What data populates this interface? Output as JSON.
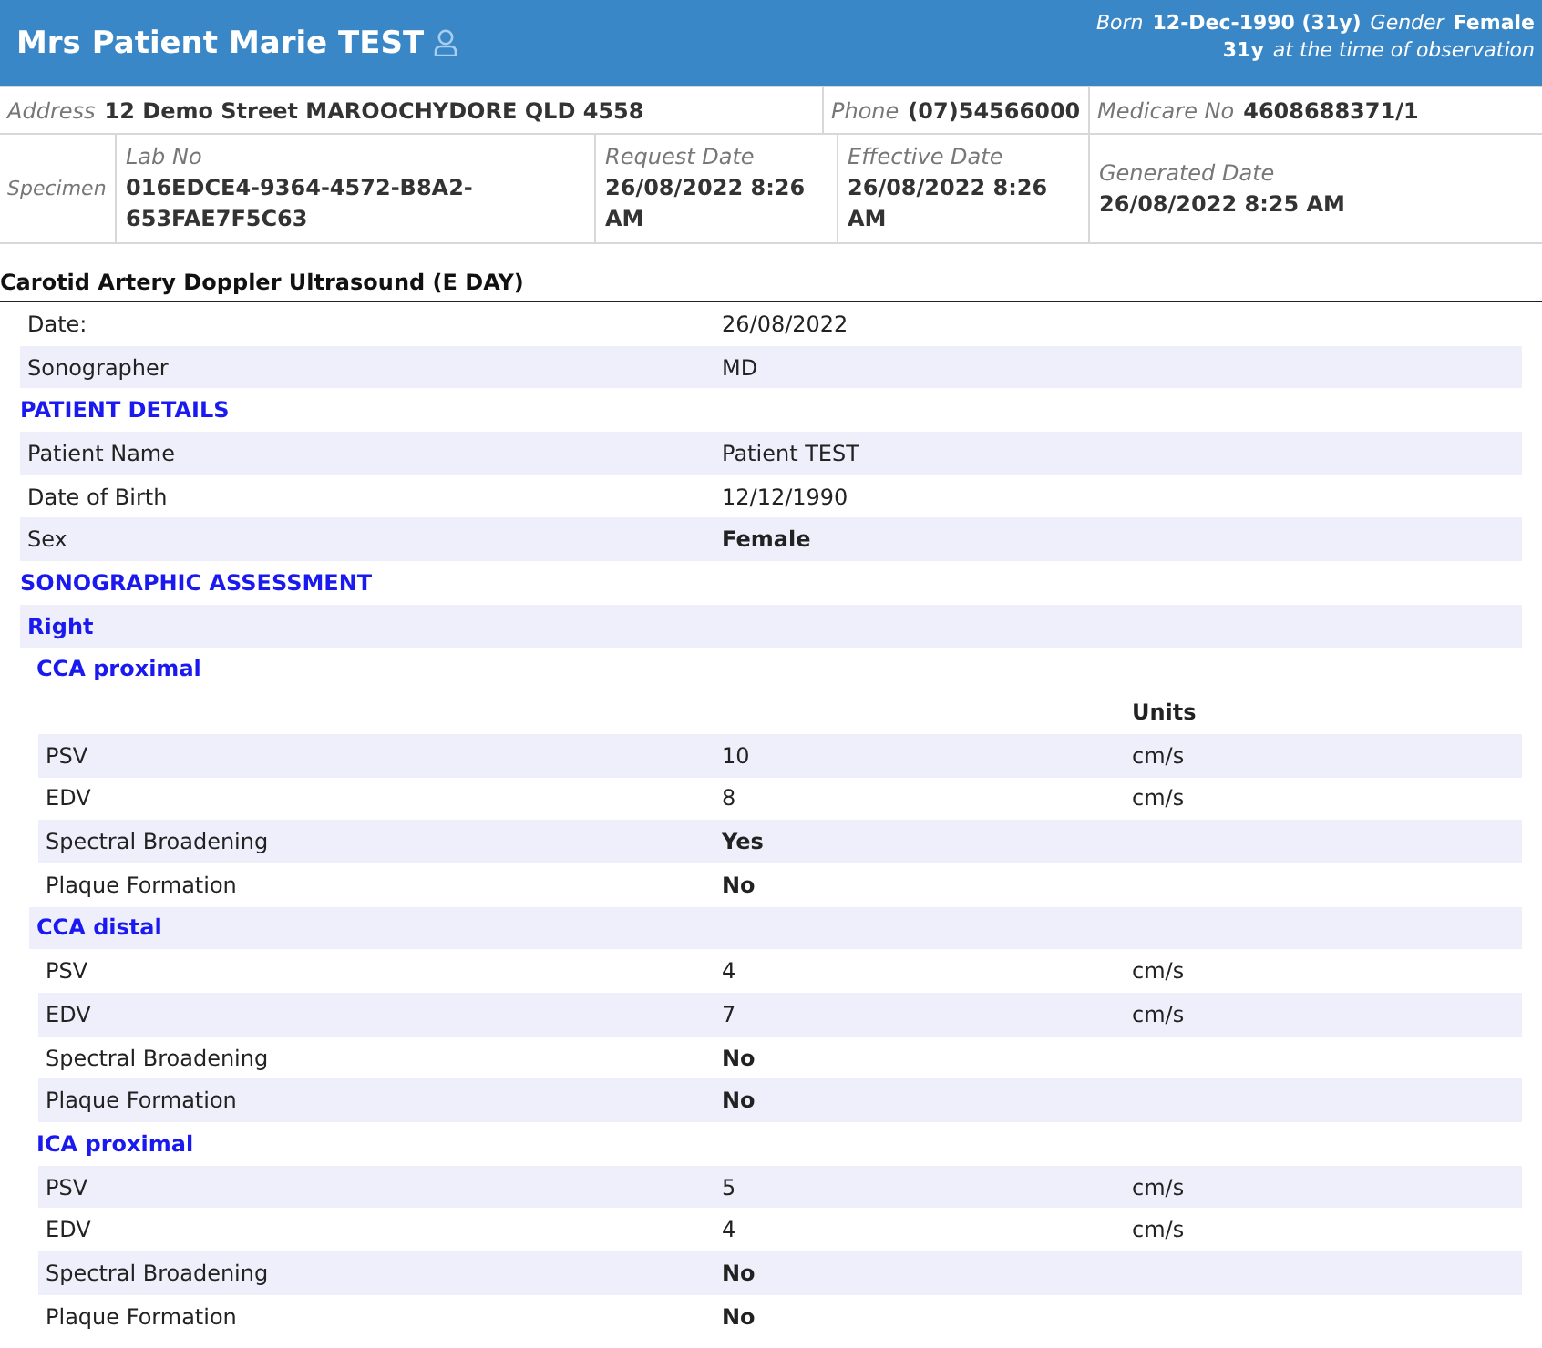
{
  "patient": {
    "name": "Mrs Patient Marie TEST",
    "born_label": "Born",
    "born": "12-Dec-1990 (31y)",
    "gender_label": "Gender",
    "gender": "Female",
    "age": "31y",
    "age_note": "at the time of observation"
  },
  "info": {
    "address_label": "Address",
    "address": "12 Demo Street MAROOCHYDORE QLD 4558",
    "phone_label": "Phone",
    "phone": "(07)54566000",
    "medicare_label": "Medicare No",
    "medicare": "4608688371/1",
    "specimen_label": "Specimen",
    "cells": [
      {
        "label": "Lab No",
        "value": "016EDCE4-9364-4572-B8A2-653FAE7F5C63"
      },
      {
        "label": "Request Date",
        "value": "26/08/2022 8:26 AM"
      },
      {
        "label": "Effective Date",
        "value": "26/08/2022 8:26 AM"
      },
      {
        "label": "Generated Date",
        "value": "26/08/2022 8:25 AM"
      }
    ]
  },
  "report": {
    "title": "Carotid Artery Doppler Ultrasound (E DAY)",
    "rows": [
      {
        "kind": "field",
        "label": "Date:",
        "value": "26/08/2022",
        "bold": false,
        "shaded": false
      },
      {
        "kind": "field",
        "label": "Sonographer",
        "value": "MD",
        "bold": false,
        "shaded": true
      },
      {
        "kind": "section",
        "title": "PATIENT DETAILS",
        "shaded": false,
        "children": [
          {
            "kind": "field",
            "label": "Patient Name",
            "value": "Patient TEST",
            "bold": false,
            "shaded": true
          },
          {
            "kind": "field",
            "label": "Date of Birth",
            "value": "12/12/1990",
            "bold": false,
            "shaded": false
          },
          {
            "kind": "field",
            "label": "Sex",
            "value": "Female",
            "bold": true,
            "shaded": true
          }
        ]
      },
      {
        "kind": "section",
        "title": "SONOGRAPHIC ASSESSMENT",
        "shaded": false,
        "children": [
          {
            "kind": "group",
            "title": "Right",
            "shaded": true,
            "children": [
              {
                "kind": "group",
                "title": "CCA proximal",
                "shaded": false,
                "children": [
                  {
                    "kind": "units_header",
                    "units": "Units",
                    "shaded": false
                  },
                  {
                    "kind": "field",
                    "label": "PSV",
                    "value": "10",
                    "units": "cm/s",
                    "bold": false,
                    "shaded": true
                  },
                  {
                    "kind": "field",
                    "label": "EDV",
                    "value": "8",
                    "units": "cm/s",
                    "bold": false,
                    "shaded": false
                  },
                  {
                    "kind": "field",
                    "label": "Spectral Broadening",
                    "value": "Yes",
                    "bold": true,
                    "shaded": true
                  },
                  {
                    "kind": "field",
                    "label": "Plaque Formation",
                    "value": "No",
                    "bold": true,
                    "shaded": false
                  }
                ]
              },
              {
                "kind": "group",
                "title": "CCA distal",
                "shaded": true,
                "children": [
                  {
                    "kind": "field",
                    "label": "PSV",
                    "value": "4",
                    "units": "cm/s",
                    "bold": false,
                    "shaded": false
                  },
                  {
                    "kind": "field",
                    "label": "EDV",
                    "value": "7",
                    "units": "cm/s",
                    "bold": false,
                    "shaded": true
                  },
                  {
                    "kind": "field",
                    "label": "Spectral Broadening",
                    "value": "No",
                    "bold": true,
                    "shaded": false
                  },
                  {
                    "kind": "field",
                    "label": "Plaque Formation",
                    "value": "No",
                    "bold": true,
                    "shaded": true
                  }
                ]
              },
              {
                "kind": "group",
                "title": "ICA proximal",
                "shaded": false,
                "children": [
                  {
                    "kind": "field",
                    "label": "PSV",
                    "value": "5",
                    "units": "cm/s",
                    "bold": false,
                    "shaded": true
                  },
                  {
                    "kind": "field",
                    "label": "EDV",
                    "value": "4",
                    "units": "cm/s",
                    "bold": false,
                    "shaded": false
                  },
                  {
                    "kind": "field",
                    "label": "Spectral Broadening",
                    "value": "No",
                    "bold": true,
                    "shaded": true
                  },
                  {
                    "kind": "field",
                    "label": "Plaque Formation",
                    "value": "No",
                    "bold": true,
                    "shaded": false
                  }
                ]
              }
            ]
          }
        ]
      }
    ]
  }
}
